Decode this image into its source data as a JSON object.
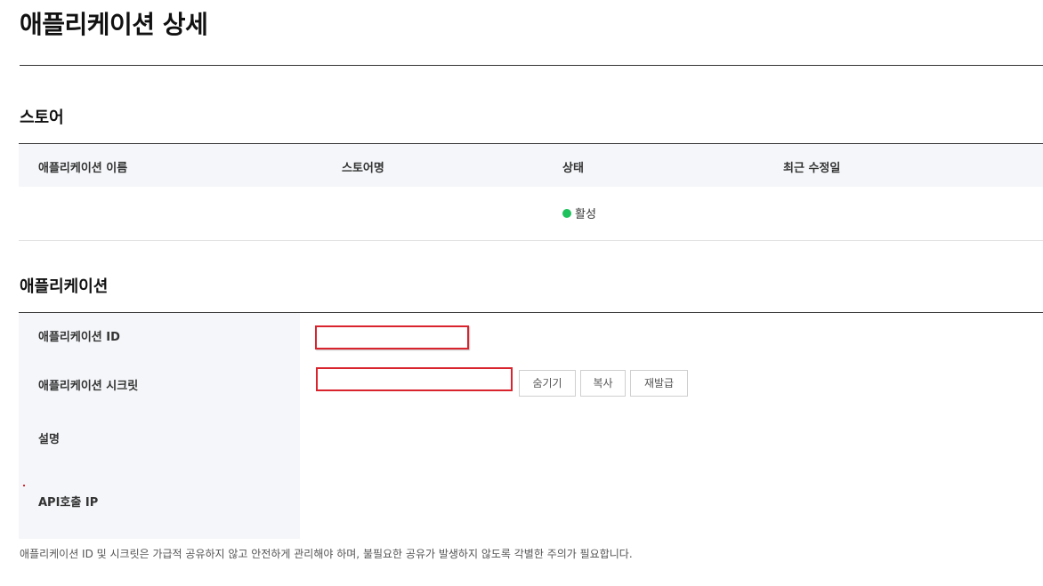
{
  "page": {
    "title": "애플리케이션 상세"
  },
  "store": {
    "section_title": "스토어",
    "columns": [
      "애플리케이션 이름",
      "스토어명",
      "상태",
      "최근 수정일"
    ],
    "row": {
      "app_name": "",
      "store_name": "",
      "status": "활성",
      "updated_at": ""
    },
    "status_color": "#1ec25c"
  },
  "application": {
    "section_title": "애플리케이션",
    "id_label": "애플리케이션 ID",
    "id_value": "",
    "secret_label": "애플리케이션 시크릿",
    "secret_value": "",
    "buttons": {
      "hide": "숨기기",
      "copy": "복사",
      "reissue": "재발급"
    },
    "description_label": "설명",
    "api_ip_label": "API호출 IP"
  },
  "notice": "애플리케이션 ID 및 시크릿은 가급적 공유하지 않고 안전하게 관리해야 하며, 불필요한 공유가 발생하지 않도록 각별한 주의가 필요합니다.",
  "colors": {
    "highlight_border": "#d9232d",
    "label_background": "#f4f6f9"
  }
}
